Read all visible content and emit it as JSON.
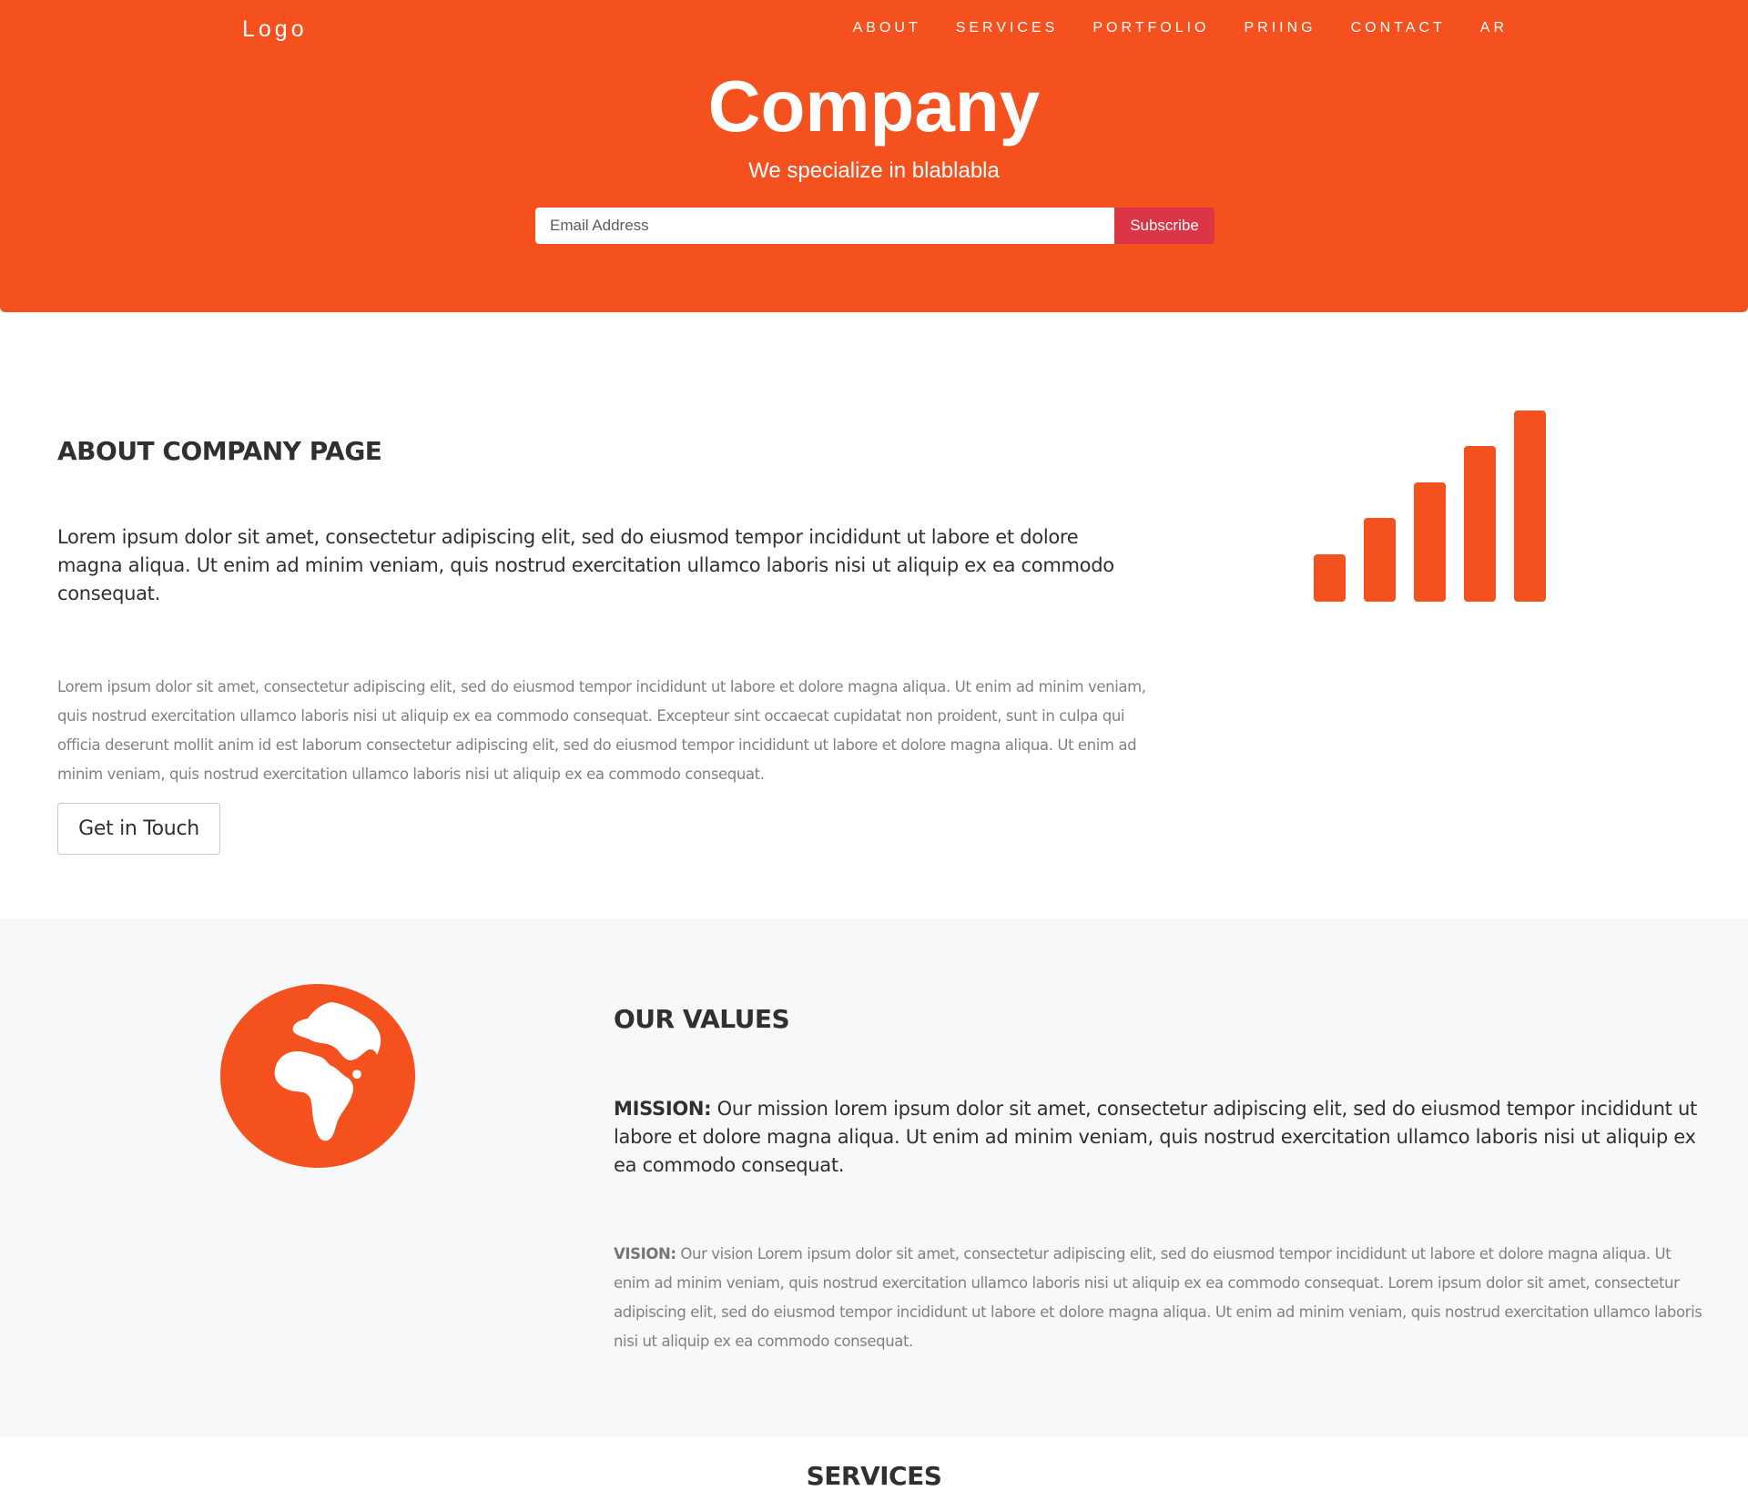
{
  "header": {
    "logo": "Logo",
    "nav": [
      "ABOUT",
      "SERVICES",
      "PORTFOLIO",
      "PRIING",
      "CONTACT",
      "AR"
    ],
    "title": "Company",
    "subtitle": "We specialize in blablabla",
    "email_placeholder": "Email Address",
    "subscribe_label": "Subscribe"
  },
  "about": {
    "title": "ABOUT COMPANY PAGE",
    "lead": "Lorem ipsum dolor sit amet, consectetur adipiscing elit, sed do eiusmod tempor incididunt ut labore et dolore magna aliqua. Ut enim ad minim veniam, quis nostrud exercitation ullamco laboris nisi ut aliquip ex ea commodo consequat.",
    "body": "Lorem ipsum dolor sit amet, consectetur adipiscing elit, sed do eiusmod tempor incididunt ut labore et dolore magna aliqua. Ut enim ad minim veniam, quis nostrud exercitation ullamco laboris nisi ut aliquip ex ea commodo consequat. Excepteur sint occaecat cupidatat non proident, sunt in culpa qui officia deserunt mollit anim id est laborum consectetur adipiscing elit, sed do eiusmod tempor incididunt ut labore et dolore magna aliqua. Ut enim ad minim veniam, quis nostrud exercitation ullamco laboris nisi ut aliquip ex ea commodo consequat.",
    "button_label": "Get in Touch",
    "icon": "signal-icon"
  },
  "values": {
    "title": "OUR VALUES",
    "mission_label": "MISSION:",
    "mission_text": " Our mission lorem ipsum dolor sit amet, consectetur adipiscing elit, sed do eiusmod tempor incididunt ut labore et dolore magna aliqua. Ut enim ad minim veniam, quis nostrud exercitation ullamco laboris nisi ut aliquip ex ea commodo consequat.",
    "vision_label": "VISION:",
    "vision_text": " Our vision Lorem ipsum dolor sit amet, consectetur adipiscing elit, sed do eiusmod tempor incididunt ut labore et dolore magna aliqua. Ut enim ad minim veniam, quis nostrud exercitation ullamco laboris nisi ut aliquip ex ea commodo consequat. Lorem ipsum dolor sit amet, consectetur adipiscing elit, sed do eiusmod tempor incididunt ut labore et dolore magna aliqua. Ut enim ad minim veniam, quis nostrud exercitation ullamco laboris nisi ut aliquip ex ea commodo consequat.",
    "icon": "globe-icon"
  },
  "services": {
    "title": "SERVICES"
  },
  "colors": {
    "brand": "#f4511e",
    "subscribe": "#dc3545",
    "section_bg": "#f7f8fa",
    "heading": "#303030",
    "muted": "#818181"
  }
}
